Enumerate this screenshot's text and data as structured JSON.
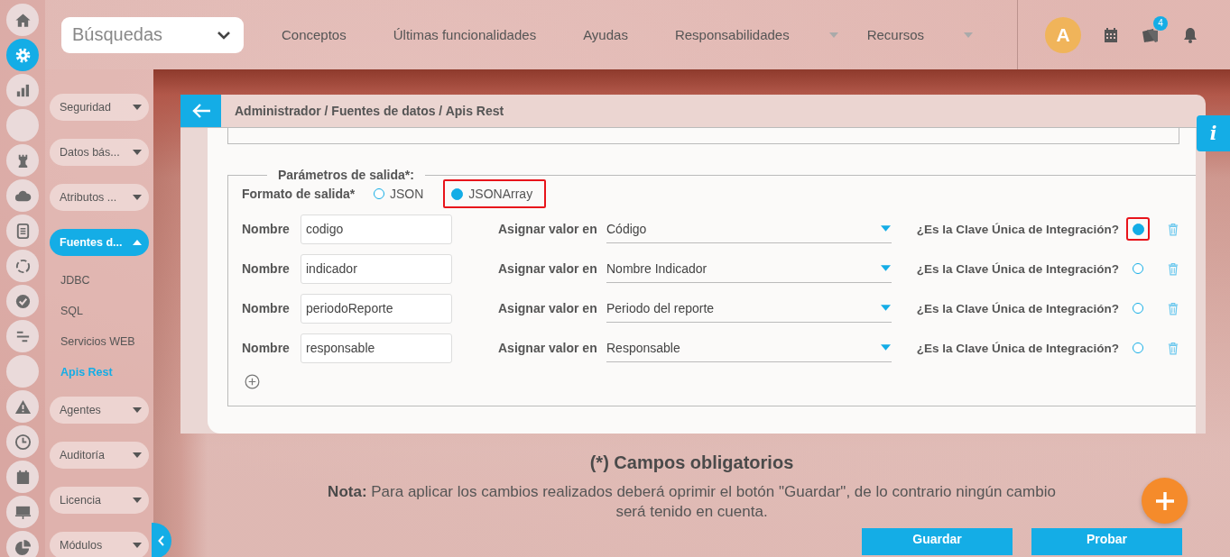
{
  "rail": [
    {
      "selected": false
    },
    {
      "selected": true
    },
    {
      "selected": false
    },
    {
      "selected": false
    },
    {
      "selected": false
    },
    {
      "selected": false
    },
    {
      "selected": false
    },
    {
      "selected": false
    },
    {
      "selected": false
    },
    {
      "selected": false
    },
    {
      "selected": false
    },
    {
      "selected": false
    },
    {
      "selected": false
    },
    {
      "selected": false
    },
    {
      "selected": false
    },
    {
      "selected": false
    }
  ],
  "search": {
    "value": "Búsquedas"
  },
  "nav": [
    {
      "label": "Conceptos",
      "has_menu": false
    },
    {
      "label": "Últimas funcionalidades",
      "has_menu": false
    },
    {
      "label": "Ayudas",
      "has_menu": false
    },
    {
      "label": "Responsabilidades",
      "has_menu": true
    },
    {
      "label": "Recursos",
      "has_menu": true
    }
  ],
  "user": {
    "avatar": "A",
    "notifications": "4"
  },
  "sidebar": {
    "items": [
      {
        "kind": "group",
        "label": "Seguridad",
        "selected": false,
        "expanded": false
      },
      {
        "kind": "group",
        "label": "Datos bás...",
        "selected": false,
        "expanded": false
      },
      {
        "kind": "group",
        "label": "Atributos ...",
        "selected": false,
        "expanded": false
      },
      {
        "kind": "group",
        "label": "Fuentes d...",
        "selected": true,
        "expanded": true
      },
      {
        "kind": "link",
        "label": "JDBC",
        "selected": false
      },
      {
        "kind": "link",
        "label": "SQL",
        "selected": false
      },
      {
        "kind": "link",
        "label": "Servicios WEB",
        "selected": false
      },
      {
        "kind": "link",
        "label": "Apis Rest",
        "selected": true
      },
      {
        "kind": "group",
        "label": "Agentes",
        "selected": false,
        "expanded": false
      },
      {
        "kind": "group",
        "label": "Auditoría",
        "selected": false,
        "expanded": false
      },
      {
        "kind": "group",
        "label": "Licencia",
        "selected": false,
        "expanded": false
      },
      {
        "kind": "group",
        "label": "Módulos",
        "selected": false,
        "expanded": false
      }
    ]
  },
  "panel": {
    "breadcrumb": "Administrador / Fuentes de datos / Apis Rest",
    "output": {
      "legend": "Parámetros de salida*:",
      "format_label": "Formato de salida*",
      "format_options": [
        {
          "label": "JSON",
          "selected": false,
          "highlighted": false
        },
        {
          "label": "JSONArray",
          "selected": true,
          "highlighted": true
        }
      ],
      "rows": [
        {
          "name_label": "Nombre",
          "name": "codigo",
          "assign_label": "Asignar valor en",
          "assign": "Código",
          "key_label": "¿Es la Clave Única de Integración?",
          "key_selected": true,
          "highlighted": true
        },
        {
          "name_label": "Nombre",
          "name": "indicador",
          "assign_label": "Asignar valor en",
          "assign": "Nombre Indicador",
          "key_label": "¿Es la Clave Única de Integración?",
          "key_selected": false,
          "highlighted": false
        },
        {
          "name_label": "Nombre",
          "name": "periodoReporte",
          "assign_label": "Asignar valor en",
          "assign": "Periodo del reporte",
          "key_label": "¿Es la Clave Única de Integración?",
          "key_selected": false,
          "highlighted": false
        },
        {
          "name_label": "Nombre",
          "name": "responsable",
          "assign_label": "Asignar valor en",
          "assign": "Responsable",
          "key_label": "¿Es la Clave Única de Integración?",
          "key_selected": false,
          "highlighted": false
        }
      ]
    }
  },
  "footer": {
    "required": "(*) Campos obligatorios",
    "note": "**Nota:** Para aplicar los cambios realizados deberá oprimir el botón \"Guardar\", de lo contrario ningún cambio será tenido en cuenta.",
    "buttons": [
      "Guardar",
      "Probar"
    ]
  },
  "info_tab": {
    "label": "i"
  }
}
